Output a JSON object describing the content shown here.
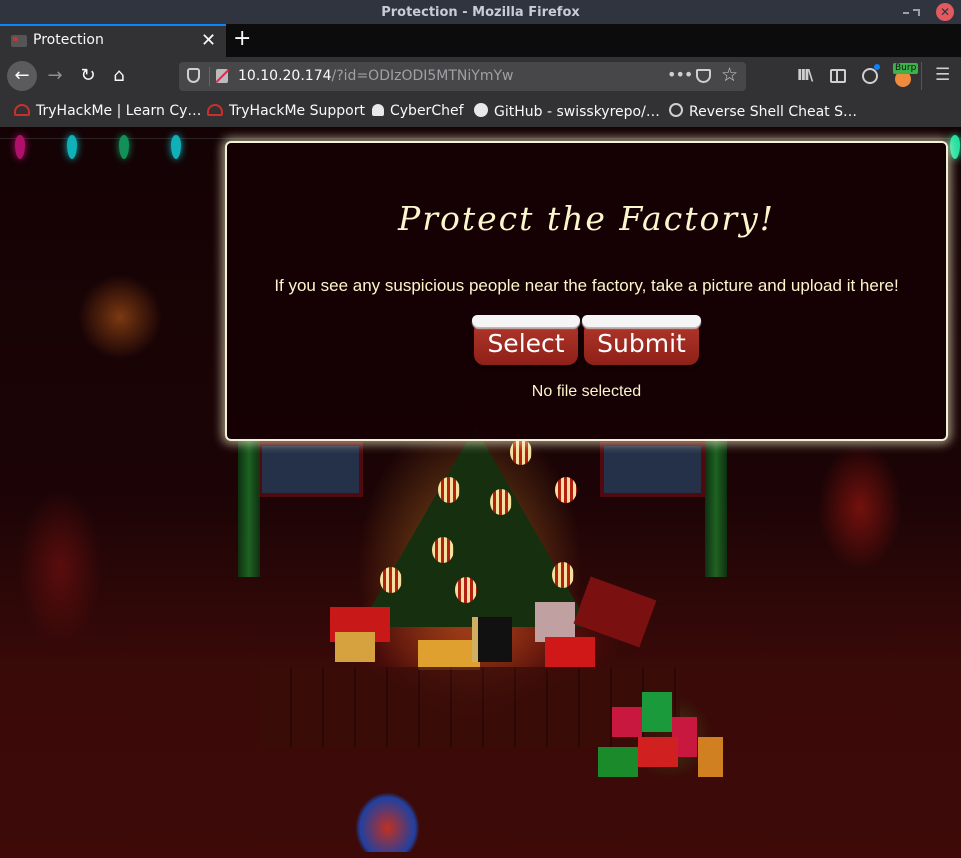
{
  "window": {
    "title": "Protection - Mozilla Firefox",
    "controls": {
      "minimize": "minimize",
      "maximize": "maximize",
      "close": "✕"
    }
  },
  "tabs": [
    {
      "label": "Protection",
      "active": true,
      "close": "✕"
    }
  ],
  "new_tab_label": "+",
  "navbar": {
    "back": "←",
    "forward": "→",
    "reload": "↻",
    "home": "⌂",
    "url_host": "10.10.20.174",
    "url_rest": "/?id=ODIzODI5MTNiYmYw",
    "more": "•••",
    "star": "☆",
    "library": "III\\",
    "menu": "☰",
    "burp_badge": "Burp"
  },
  "bookmarks": [
    {
      "label": "TryHackMe | Learn Cy…",
      "icon": "tryhackme-icon"
    },
    {
      "label": "TryHackMe Support",
      "icon": "tryhackme-icon"
    },
    {
      "label": "CyberChef",
      "icon": "chef-hat-icon"
    },
    {
      "label": "GitHub - swisskyrepo/…",
      "icon": "github-icon"
    },
    {
      "label": "Reverse Shell Cheat S…",
      "icon": "globe-icon"
    }
  ],
  "page": {
    "heading": "Protect the Factory!",
    "description": "If you see any suspicious people near the factory, take a picture and upload it here!",
    "select_button": "Select",
    "submit_button": "Submit",
    "file_status": "No file selected"
  },
  "colors": {
    "heading_text": "#fbf6cb",
    "button_red": "#a02b22",
    "card_border": "#f3f0d8",
    "tab_accent": "#0a84ff"
  }
}
